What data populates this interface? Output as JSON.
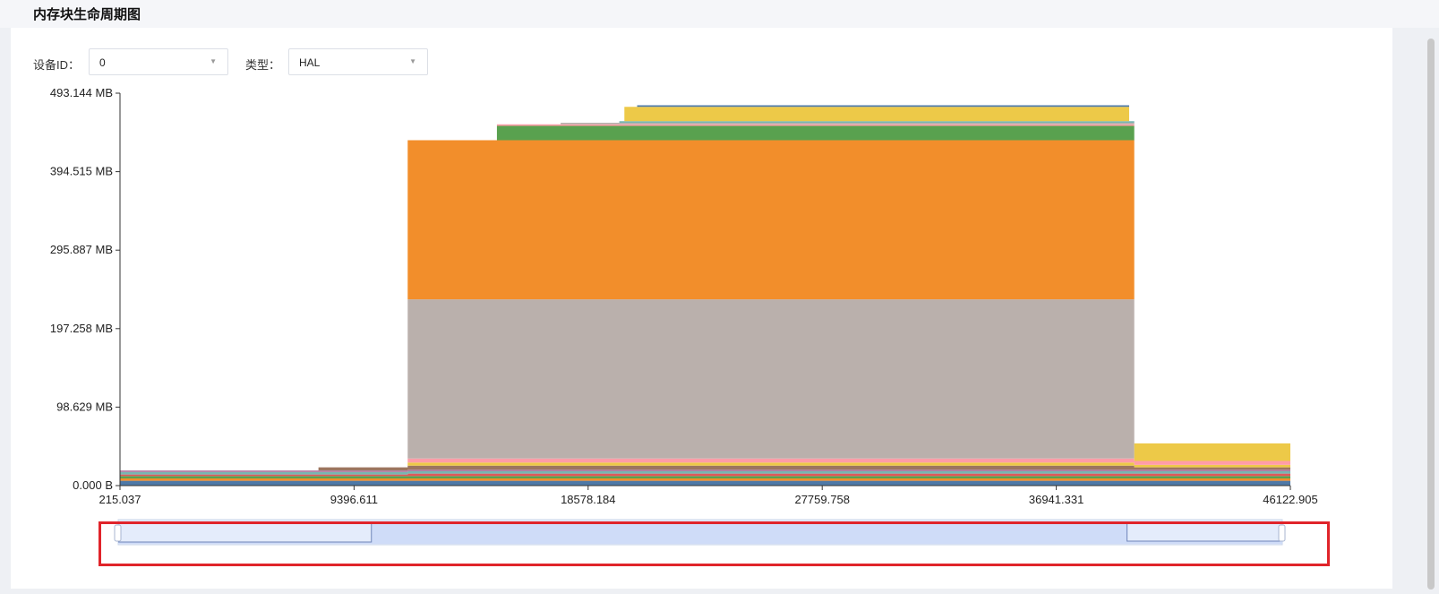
{
  "page": {
    "title": "内存块生命周期图"
  },
  "filters": {
    "device_label": "设备ID：",
    "device_value": "0",
    "type_label": "类型：",
    "type_value": "HAL"
  },
  "chart_data": {
    "type": "area",
    "title": "",
    "xlabel": "",
    "ylabel": "",
    "x_ticks": [
      "215.037",
      "9396.611",
      "18578.184",
      "27759.758",
      "36941.331",
      "46122.905"
    ],
    "y_ticks": [
      "0.000 B",
      "98.629 MB",
      "197.258 MB",
      "295.887 MB",
      "394.515 MB",
      "493.144 MB"
    ],
    "xlim": [
      215.037,
      46122.905
    ],
    "ylim_mb": [
      0,
      493.144
    ],
    "series_stacked_mb": [
      {
        "color": "#4e79a7",
        "points": [
          [
            215.037,
            6
          ],
          [
            46122.905,
            6
          ]
        ]
      },
      {
        "color": "#f28e2b",
        "points": [
          [
            215.037,
            3
          ],
          [
            46122.905,
            3
          ]
        ]
      },
      {
        "color": "#59a14f",
        "points": [
          [
            215.037,
            3
          ],
          [
            46122.905,
            3
          ]
        ]
      },
      {
        "color": "#e15759",
        "points": [
          [
            215.037,
            2
          ],
          [
            11500,
            2
          ],
          [
            11500,
            3
          ],
          [
            46122.905,
            3
          ]
        ]
      },
      {
        "color": "#76b7b2",
        "points": [
          [
            215.037,
            3
          ],
          [
            46122.905,
            3
          ]
        ]
      },
      {
        "color": "#b07aa1",
        "points": [
          [
            215.037,
            2
          ],
          [
            46122.905,
            2
          ]
        ]
      },
      {
        "color": "#9c755f",
        "points": [
          [
            8000,
            0
          ],
          [
            8000,
            4
          ],
          [
            11500,
            4
          ],
          [
            11500,
            5
          ],
          [
            40000,
            5
          ],
          [
            40000,
            3
          ],
          [
            46122.905,
            3
          ]
        ]
      },
      {
        "color": "#edc948",
        "points": [
          [
            11500,
            0
          ],
          [
            11500,
            4
          ],
          [
            40000,
            4
          ],
          [
            40000,
            3
          ],
          [
            46122.905,
            3
          ]
        ]
      },
      {
        "color": "#ff9da7",
        "points": [
          [
            11500,
            0
          ],
          [
            11500,
            5
          ],
          [
            40000,
            5
          ],
          [
            40000,
            5
          ],
          [
            46122.905,
            5
          ]
        ]
      },
      {
        "color": "#bab0ac",
        "points": [
          [
            11500,
            0
          ],
          [
            11500,
            200
          ],
          [
            40000,
            200
          ],
          [
            40000,
            0
          ]
        ]
      },
      {
        "color": "#f28e2b",
        "points": [
          [
            11500,
            0
          ],
          [
            11500,
            200
          ],
          [
            40000,
            200
          ],
          [
            40000,
            0
          ]
        ]
      },
      {
        "color": "#59a14f",
        "points": [
          [
            15000,
            0
          ],
          [
            15000,
            18
          ],
          [
            40000,
            18
          ],
          [
            40000,
            0
          ]
        ]
      },
      {
        "color": "#ff9da7",
        "points": [
          [
            15000,
            0
          ],
          [
            15000,
            2
          ],
          [
            40000,
            2
          ],
          [
            40000,
            0
          ]
        ]
      },
      {
        "color": "#bab0ac",
        "points": [
          [
            17500,
            0
          ],
          [
            17500,
            2
          ],
          [
            40000,
            2
          ],
          [
            40000,
            0
          ]
        ]
      },
      {
        "color": "#76b7b2",
        "points": [
          [
            19800,
            0
          ],
          [
            19800,
            2
          ],
          [
            40000,
            2
          ],
          [
            40000,
            0
          ]
        ]
      },
      {
        "color": "#edc948",
        "points": [
          [
            20000,
            0
          ],
          [
            20000,
            18
          ],
          [
            39800,
            18
          ],
          [
            39800,
            0
          ],
          [
            40000,
            0
          ],
          [
            40000,
            22
          ],
          [
            46122.905,
            22
          ]
        ]
      },
      {
        "color": "#4e79a7",
        "points": [
          [
            20500,
            0
          ],
          [
            20500,
            2
          ],
          [
            39800,
            2
          ],
          [
            39800,
            0
          ]
        ]
      }
    ],
    "navigator": {
      "line_mb": [
        [
          215.037,
          20
        ],
        [
          10200,
          20
        ],
        [
          10200,
          450
        ],
        [
          40000,
          450
        ],
        [
          40000,
          40
        ],
        [
          46122.905,
          40
        ]
      ]
    }
  }
}
